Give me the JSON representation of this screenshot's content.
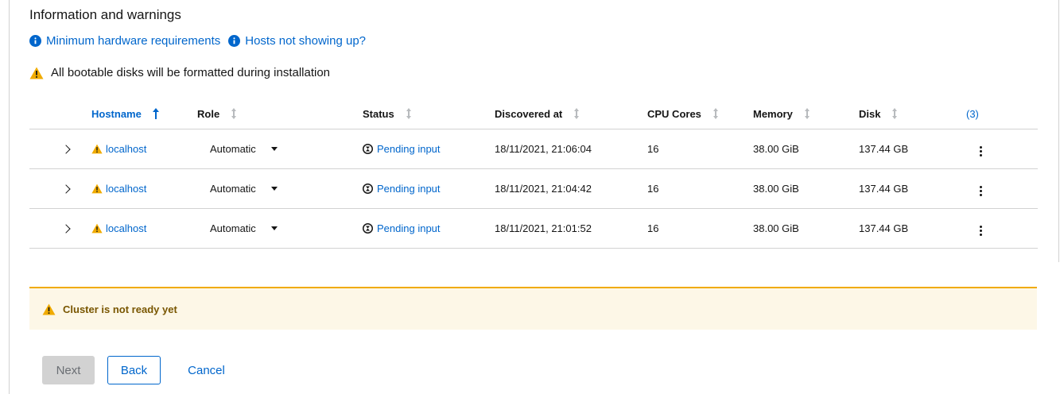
{
  "section_title": "Information and warnings",
  "links": {
    "hardware": "Minimum hardware requirements",
    "hosts_missing": "Hosts not showing up?"
  },
  "disk_warning": "All bootable disks will be formatted during installation",
  "table": {
    "columns": {
      "hostname": "Hostname",
      "role": "Role",
      "status": "Status",
      "discovered": "Discovered at",
      "cpu": "CPU Cores",
      "memory": "Memory",
      "disk": "Disk",
      "count": "(3)"
    },
    "rows": [
      {
        "hostname": "localhost",
        "role": "Automatic",
        "status": "Pending input",
        "discovered": "18/11/2021, 21:06:04",
        "cpu": "16",
        "memory": "38.00 GiB",
        "disk": "137.44 GB"
      },
      {
        "hostname": "localhost",
        "role": "Automatic",
        "status": "Pending input",
        "discovered": "18/11/2021, 21:04:42",
        "cpu": "16",
        "memory": "38.00 GiB",
        "disk": "137.44 GB"
      },
      {
        "hostname": "localhost",
        "role": "Automatic",
        "status": "Pending input",
        "discovered": "18/11/2021, 21:01:52",
        "cpu": "16",
        "memory": "38.00 GiB",
        "disk": "137.44 GB"
      }
    ]
  },
  "alert": {
    "text": "Cluster is not ready yet"
  },
  "buttons": {
    "next": "Next",
    "back": "Back",
    "cancel": "Cancel"
  },
  "colors": {
    "link": "#0066cc",
    "warning": "#f0ab00",
    "alert_bg": "#fdf7e7",
    "alert_text": "#795600"
  },
  "icons": {
    "info": "info-circle-icon",
    "warning": "warning-triangle-icon",
    "pending": "hourglass-icon",
    "sort": "sort-arrows-icon",
    "expand": "chevron-right-icon",
    "kebab": "kebab-menu-icon"
  }
}
